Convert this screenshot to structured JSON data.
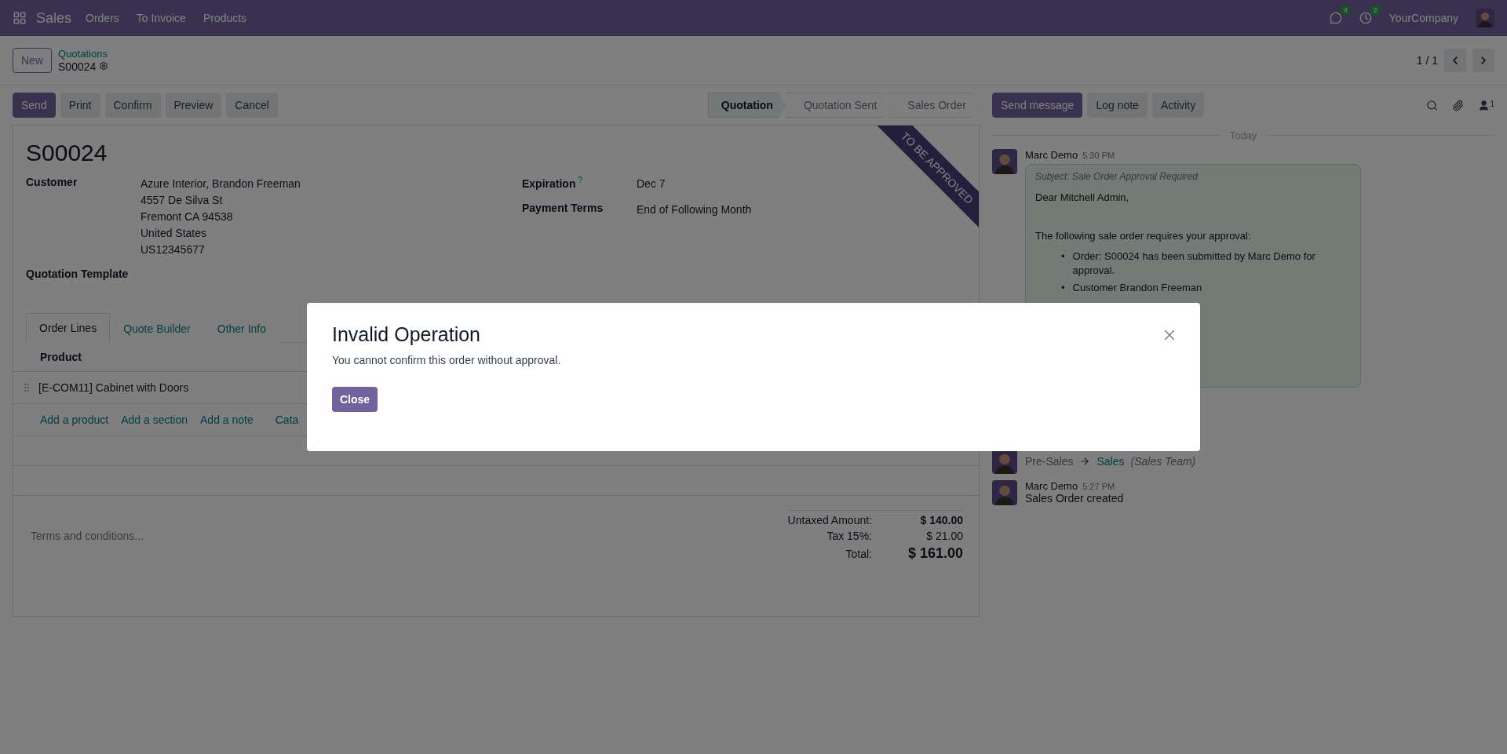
{
  "navbar": {
    "app": "Sales",
    "menu": [
      "Orders",
      "To Invoice",
      "Products"
    ],
    "messages_count": "4",
    "activities_count": "2",
    "company": "YourCompany"
  },
  "control_panel": {
    "new_button": "New",
    "breadcrumb": "Quotations",
    "record": "S00024",
    "pager": "1 / 1"
  },
  "actions": [
    {
      "label": "Send",
      "primary": true
    },
    {
      "label": "Print",
      "primary": false
    },
    {
      "label": "Confirm",
      "primary": false
    },
    {
      "label": "Preview",
      "primary": false
    },
    {
      "label": "Cancel",
      "primary": false
    }
  ],
  "status_steps": [
    {
      "label": "Quotation",
      "selected": true
    },
    {
      "label": "Quotation Sent",
      "selected": false
    },
    {
      "label": "Sales Order",
      "selected": false
    }
  ],
  "form": {
    "title": "S00024",
    "ribbon": "TO BE APPROVED",
    "customer": {
      "label": "Customer",
      "lines": [
        "Azure Interior, Brandon Freeman",
        "4557 De Silva St",
        "Fremont CA 94538",
        "United States",
        "US12345677"
      ]
    },
    "expiration": {
      "label": "Expiration",
      "help": "?",
      "value": "Dec 7"
    },
    "payment_terms": {
      "label": "Payment Terms",
      "value": "End of Following Month"
    },
    "quotation_template": {
      "label": "Quotation Template"
    },
    "tabs": [
      {
        "label": "Order Lines",
        "selected": true
      },
      {
        "label": "Quote Builder",
        "selected": false
      },
      {
        "label": "Other Info",
        "selected": false
      }
    ],
    "table": {
      "columns": [
        "Product"
      ],
      "rows": [
        [
          "[E-COM11] Cabinet with Doors"
        ]
      ],
      "add_links": [
        "Add a product",
        "Add a section",
        "Add a note",
        "Cata"
      ]
    },
    "terms_placeholder": "Terms and conditions...",
    "totals": [
      {
        "label": "Untaxed Amount:",
        "value": "$ 140.00",
        "kind": "bold"
      },
      {
        "label": "Tax 15%:",
        "value": "$ 21.00",
        "kind": "plain"
      },
      {
        "label": "Total:",
        "value": "$ 161.00",
        "kind": "grand"
      }
    ]
  },
  "chatter": {
    "buttons": [
      {
        "label": "Send message",
        "primary": true
      },
      {
        "label": "Log note",
        "primary": false
      },
      {
        "label": "Activity",
        "primary": false
      }
    ],
    "followers_count": "1",
    "divider": "Today",
    "messages": [
      {
        "kind": "email",
        "author": "Marc Demo",
        "time": "5:30 PM",
        "subject": "Subject: Sale Order Approval Required",
        "greeting": "Dear Mitchell Admin,",
        "intro": "The following sale order requires your approval:",
        "marker": "•",
        "bullets": [
          "Order: S00024 has been submitted by Marc Demo for approval.",
          "Customer Brandon Freeman"
        ]
      },
      {
        "kind": "tracking",
        "from": "Pre-Sales",
        "to": "Sales",
        "field": "(Sales Team)"
      },
      {
        "kind": "note",
        "author": "Marc Demo",
        "time": "5:27 PM",
        "body": "Sales Order created"
      }
    ]
  },
  "dialog": {
    "title": "Invalid Operation",
    "message": "You cannot confirm this order without approval.",
    "button": "Close"
  }
}
